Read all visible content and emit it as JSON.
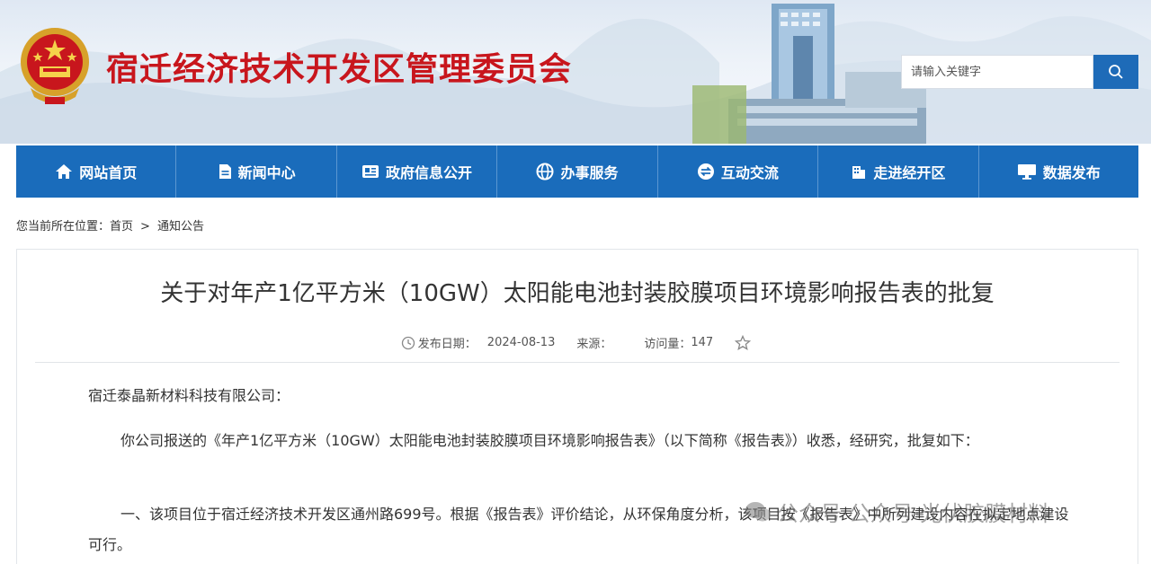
{
  "header": {
    "site_title": "宿迁经济技术开发区管理委员会",
    "search_placeholder": "请输入关键字",
    "emblem_icon": "national-emblem-icon",
    "search_icon": "search-icon"
  },
  "nav": {
    "items": [
      {
        "label": "网站首页",
        "icon": "home-icon"
      },
      {
        "label": "新闻中心",
        "icon": "document-icon"
      },
      {
        "label": "政府信息公开",
        "icon": "info-card-icon"
      },
      {
        "label": "办事服务",
        "icon": "globe-icon"
      },
      {
        "label": "互动交流",
        "icon": "exchange-icon"
      },
      {
        "label": "走进经开区",
        "icon": "building-icon"
      },
      {
        "label": "数据发布",
        "icon": "monitor-icon"
      }
    ]
  },
  "breadcrumb": {
    "prefix": "您当前所在位置：",
    "home": "首页",
    "separator": ">",
    "current": "通知公告"
  },
  "article": {
    "title": "关于对年产1亿平方米（10GW）太阳能电池封装胶膜项目环境影响报告表的批复",
    "publish_label": "发布日期：",
    "publish_date": "2024-08-13",
    "source_label": "来源：",
    "views_label": "访问量：",
    "views": "147",
    "salutation": "宿迁泰晶新材料科技有限公司：",
    "paragraph1": "你公司报送的《年产1亿平方米（10GW）太阳能电池封装胶膜项目环境影响报告表》（以下简称《报告表》）收悉，经研究，批复如下：",
    "paragraph2": "一、该项目位于宿迁经济技术开发区通州路699号。根据《报告表》评价结论，从环保角度分析，该项目按《报告表》中所列建设内容在拟定地点建设可行。"
  },
  "watermark": {
    "text": "公众号·公众号·光伏胶膜材料",
    "icon": "wechat-icon"
  },
  "colors": {
    "nav_blue": "#1a6cbb",
    "title_red": "#c8161d",
    "search_blue": "#1e6bb8"
  }
}
